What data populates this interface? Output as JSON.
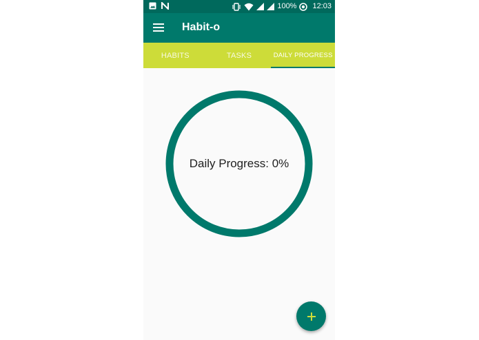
{
  "status_bar": {
    "battery": "100%",
    "time": "12:03"
  },
  "app_bar": {
    "title": "Habit-o"
  },
  "tabs": [
    {
      "label": "HABITS",
      "active": false
    },
    {
      "label": "TASKS",
      "active": false
    },
    {
      "label": "DAILY PROGRESS",
      "active": true
    }
  ],
  "progress": {
    "label": "Daily Progress: 0%",
    "value": 0
  },
  "icons": {
    "menu": "menu-icon",
    "fab": "add-icon"
  },
  "colors": {
    "primary_dark": "#00695c",
    "primary": "#00796b",
    "accent": "#cddc39",
    "ring": "#00796b",
    "fab_plus": "#cddc39"
  }
}
